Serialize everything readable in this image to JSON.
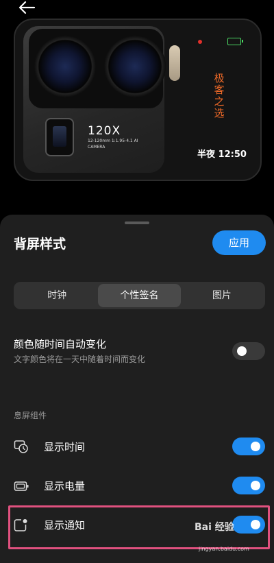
{
  "preview": {
    "camera_brand": "120X",
    "camera_spec": "12-120mm 1:1.95-4.1 AI CAMERA",
    "signature_text": "极客之选",
    "time_text": "半夜 12:50"
  },
  "sheet": {
    "title": "背屏样式",
    "apply_label": "应用",
    "tabs": [
      {
        "label": "时钟",
        "active": false
      },
      {
        "label": "个性签名",
        "active": true
      },
      {
        "label": "图片",
        "active": false
      }
    ],
    "auto_color": {
      "title": "颜色随时间自动变化",
      "subtitle": "文字颜色将在一天中随着时间而变化",
      "enabled": false
    },
    "section_label": "息屏组件",
    "widgets": [
      {
        "label": "显示时间",
        "icon": "clock-icon",
        "enabled": true
      },
      {
        "label": "显示电量",
        "icon": "battery-icon",
        "enabled": true
      },
      {
        "label": "显示通知",
        "icon": "notification-icon",
        "enabled": true
      }
    ]
  },
  "watermark": {
    "text": "Bai 经验",
    "url": "jingyan.baidu.com"
  },
  "colors": {
    "accent": "#1f8bf0",
    "highlight": "#e0517f",
    "signature": "#f06a28"
  }
}
